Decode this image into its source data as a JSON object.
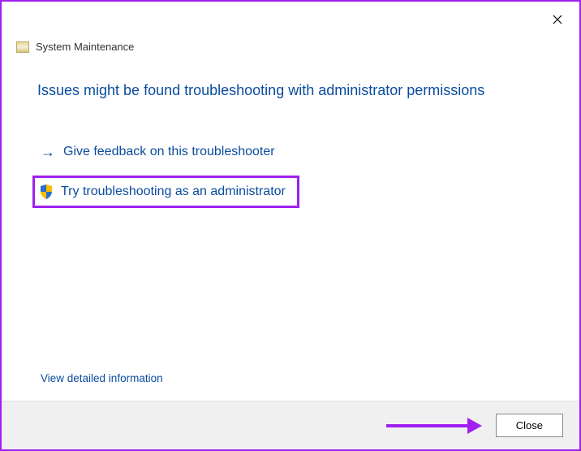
{
  "window": {
    "title": "System Maintenance"
  },
  "content": {
    "heading": "Issues might be found troubleshooting with administrator permissions",
    "feedback_link": "Give feedback on this troubleshooter",
    "admin_link": "Try troubleshooting as an administrator",
    "detailed_link": "View detailed information"
  },
  "footer": {
    "close_label": "Close"
  }
}
